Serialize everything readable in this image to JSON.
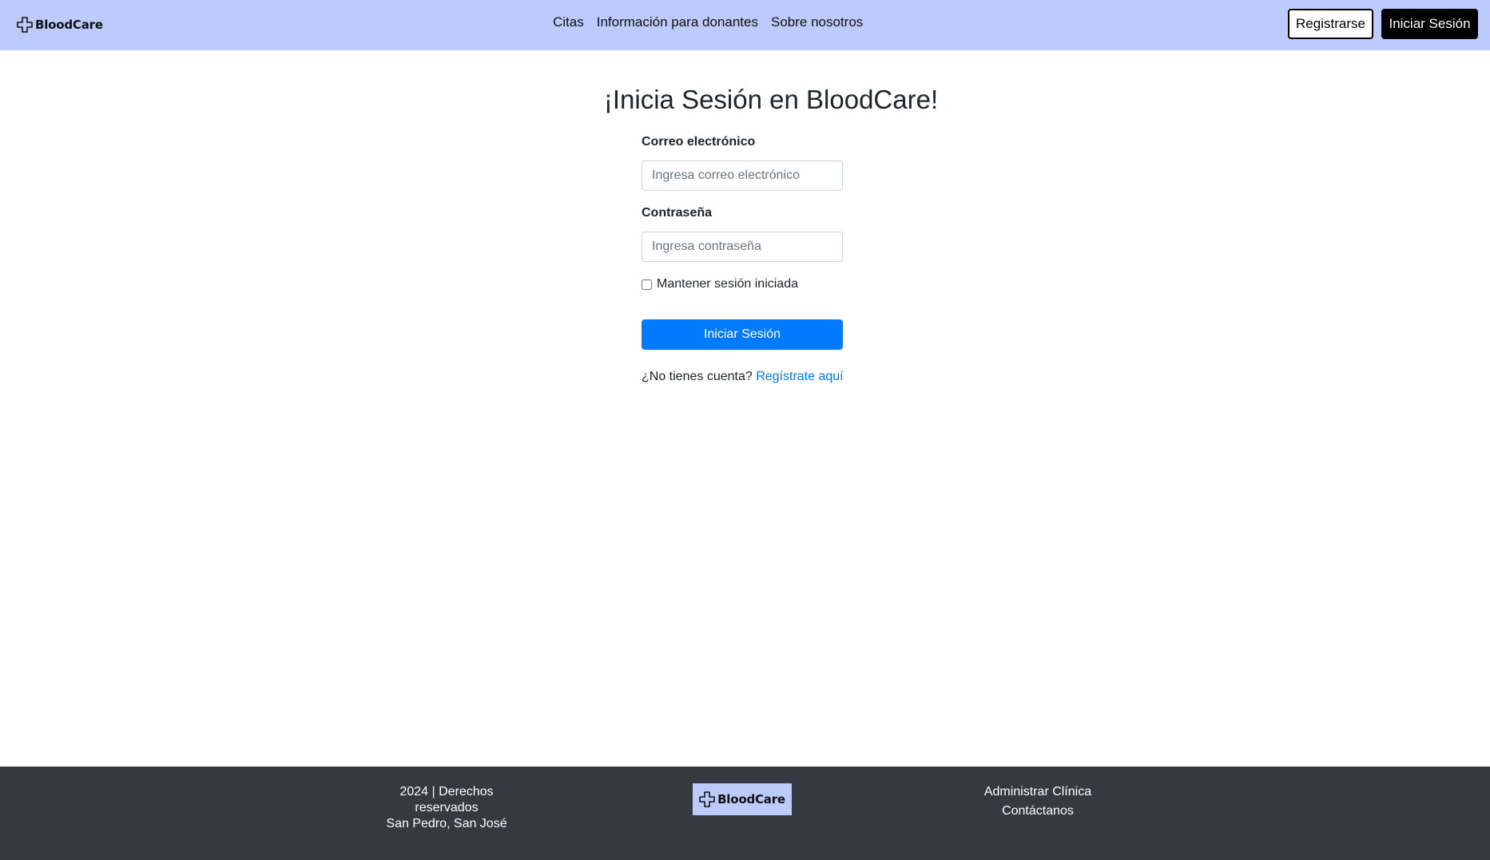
{
  "brand": {
    "name": "BloodCare",
    "logo_icon": "medical-cross-icon"
  },
  "nav": {
    "links": [
      "Citas",
      "Información para donantes",
      "Sobre nosotros"
    ],
    "register_label": "Registrarse",
    "login_label": "Iniciar Sesión"
  },
  "login": {
    "title": "¡Inicia Sesión en BloodCare!",
    "email_label": "Correo electrónico",
    "email_placeholder": "Ingresa correo electrónico",
    "email_value": "",
    "password_label": "Contraseña",
    "password_placeholder": "Ingresa contraseña",
    "password_value": "",
    "remember_label": "Mantener sesión iniciada",
    "remember_checked": false,
    "submit_label": "Iniciar Sesión",
    "no_account_text": "¿No tienes cuenta?",
    "signup_link_label": "Regístrate aquí"
  },
  "footer": {
    "copyright": "2024 | Derechos reservados",
    "location": "San Pedro, San José",
    "links": [
      "Administrar Clínica",
      "Contáctanos"
    ]
  },
  "colors": {
    "navbar_bg": "#bccbfb",
    "primary": "#007bff",
    "footer_bg": "#343a40"
  }
}
